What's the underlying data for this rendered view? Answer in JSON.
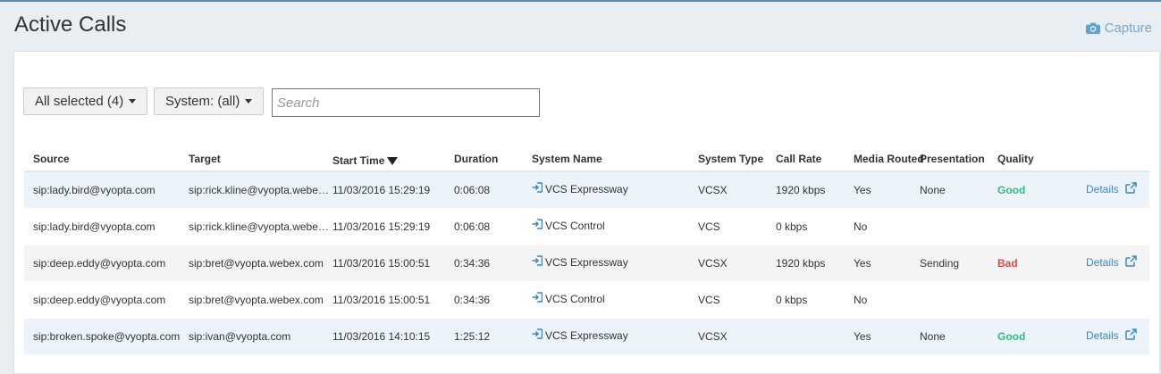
{
  "header": {
    "title": "Active Calls",
    "capture_label": "Capture"
  },
  "filters": {
    "participants_label": "All selected (4)",
    "system_label": "System: (all)",
    "search_placeholder": "Search"
  },
  "table": {
    "columns": {
      "source": "Source",
      "target": "Target",
      "start_time": "Start Time",
      "duration": "Duration",
      "system_name": "System Name",
      "system_type": "System Type",
      "call_rate": "Call Rate",
      "media_routed": "Media Routed",
      "presentation": "Presentation",
      "quality": "Quality"
    },
    "rows": [
      {
        "source": "sip:lady.bird@vyopta.com",
        "target": "sip:rick.kline@vyopta.webex.c...",
        "start_time": "11/03/2016 15:29:19",
        "duration": "0:06:08",
        "system_name": "VCS Expressway",
        "system_type": "VCSX",
        "call_rate": "1920 kbps",
        "media_routed": "Yes",
        "presentation": "None",
        "quality": "Good",
        "details": "Details"
      },
      {
        "source": "sip:lady.bird@vyopta.com",
        "target": "sip:rick.kline@vyopta.webex.c...",
        "start_time": "11/03/2016 15:29:19",
        "duration": "0:06:08",
        "system_name": "VCS Control",
        "system_type": "VCS",
        "call_rate": "0 kbps",
        "media_routed": "No",
        "presentation": "",
        "quality": "",
        "details": ""
      },
      {
        "source": "sip:deep.eddy@vyopta.com",
        "target": "sip:bret@vyopta.webex.com",
        "start_time": "11/03/2016 15:00:51",
        "duration": "0:34:36",
        "system_name": "VCS Expressway",
        "system_type": "VCSX",
        "call_rate": "1920 kbps",
        "media_routed": "Yes",
        "presentation": "Sending",
        "quality": "Bad",
        "details": "Details"
      },
      {
        "source": "sip:deep.eddy@vyopta.com",
        "target": "sip:bret@vyopta.webex.com",
        "start_time": "11/03/2016 15:00:51",
        "duration": "0:34:36",
        "system_name": "VCS Control",
        "system_type": "VCS",
        "call_rate": "0 kbps",
        "media_routed": "No",
        "presentation": "",
        "quality": "",
        "details": ""
      },
      {
        "source": "sip:broken.spoke@vyopta.com",
        "target": "sip:ivan@vyopta.com",
        "start_time": "11/03/2016 14:10:15",
        "duration": "1:25:12",
        "system_name": "VCS Expressway",
        "system_type": "VCSX",
        "call_rate": "",
        "media_routed": "Yes",
        "presentation": "None",
        "quality": "Good",
        "details": "Details"
      }
    ]
  },
  "icons": {
    "capture": "camera-icon",
    "system": "sign-in-icon",
    "details": "external-link-icon",
    "sort": "sort-desc-icon"
  },
  "colors": {
    "link": "#3a88c3",
    "good": "#2ebd7e",
    "bad": "#e04848",
    "row_highlight": "#edf3fa"
  }
}
